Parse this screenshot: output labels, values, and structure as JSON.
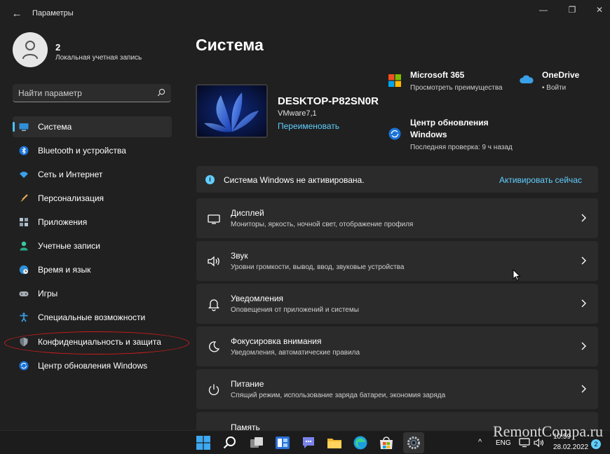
{
  "window": {
    "title": "Параметры",
    "back_glyph": "←",
    "minimize_glyph": "—",
    "maximize_glyph": "❐",
    "close_glyph": "✕"
  },
  "user": {
    "name": "2",
    "account_type": "Локальная учетная запись"
  },
  "search": {
    "placeholder": "Найти параметр"
  },
  "sidebar": {
    "items": [
      {
        "label": "Система",
        "icon": "monitor-icon",
        "selected": true
      },
      {
        "label": "Bluetooth и устройства",
        "icon": "bluetooth-icon"
      },
      {
        "label": "Сеть и Интернет",
        "icon": "wifi-icon"
      },
      {
        "label": "Персонализация",
        "icon": "brush-icon"
      },
      {
        "label": "Приложения",
        "icon": "apps-icon"
      },
      {
        "label": "Учетные записи",
        "icon": "person-icon"
      },
      {
        "label": "Время и язык",
        "icon": "globe-clock-icon"
      },
      {
        "label": "Игры",
        "icon": "gamepad-icon"
      },
      {
        "label": "Специальные возможности",
        "icon": "accessibility-icon"
      },
      {
        "label": "Конфиденциальность и защита",
        "icon": "shield-icon"
      },
      {
        "label": "Центр обновления Windows",
        "icon": "update-icon"
      }
    ]
  },
  "main": {
    "page_title": "Система",
    "device": {
      "name": "DESKTOP-P82SN0R",
      "model": "VMware7,1",
      "rename_label": "Переименовать"
    },
    "tiles": {
      "ms365": {
        "title": "Microsoft 365",
        "subtitle": "Просмотреть преимущества"
      },
      "onedrive": {
        "title": "OneDrive",
        "subtitle": "• Войти"
      },
      "update": {
        "title_line1": "Центр обновления",
        "title_line2": "Windows",
        "subtitle": "Последняя проверка: 9 ч назад"
      }
    },
    "activation": {
      "text": "Система Windows не активирована.",
      "link": "Активировать сейчас"
    },
    "cards": [
      {
        "title": "Дисплей",
        "subtitle": "Мониторы, яркость, ночной свет, отображение профиля",
        "icon": "display-icon"
      },
      {
        "title": "Звук",
        "subtitle": "Уровни громкости, вывод, ввод, звуковые устройства",
        "icon": "speaker-icon"
      },
      {
        "title": "Уведомления",
        "subtitle": "Оповещения от приложений и системы",
        "icon": "bell-icon"
      },
      {
        "title": "Фокусировка внимания",
        "subtitle": "Уведомления, автоматические правила",
        "icon": "moon-icon"
      },
      {
        "title": "Питание",
        "subtitle": "Спящий режим, использование заряда батареи, экономия заряда",
        "icon": "power-icon"
      },
      {
        "title": "Память",
        "subtitle": "",
        "icon": ""
      }
    ]
  },
  "taskbar": {
    "language": "ENG",
    "time": "10:59",
    "date": "28.02.2022",
    "notifications": "2",
    "tray_chevron": "^"
  },
  "watermark": "RemontCompa.ru"
}
